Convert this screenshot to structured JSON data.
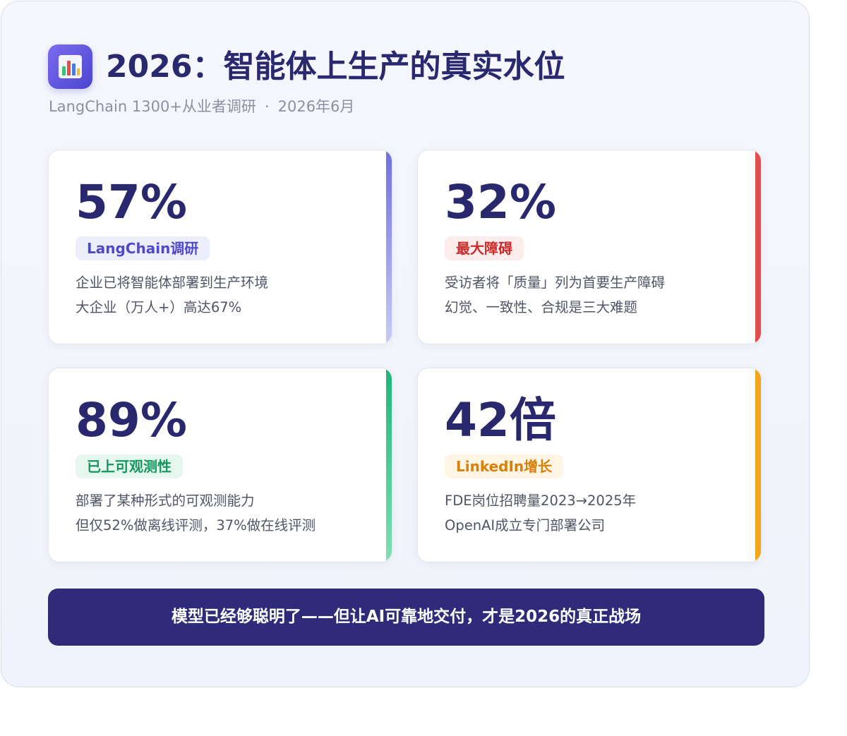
{
  "header": {
    "icon": "bar-chart-icon",
    "title": "2026：智能体上生产的真实水位",
    "subtitle_source": "LangChain 1300+从业者调研",
    "subtitle_separator": "·",
    "subtitle_date": "2026年6月"
  },
  "cards": [
    {
      "stat": "57%",
      "tag": "LangChain调研",
      "line1": "企业已将智能体部署到生产环境",
      "line2": "大企业（万人+）高达67%",
      "accent_color": "#6f6fe0",
      "tag_bg": "#eceefb",
      "tag_color": "#4f48c9"
    },
    {
      "stat": "32%",
      "tag": "最大障碍",
      "line1": "受访者将「质量」列为首要生产障碍",
      "line2": "幻觉、一致性、合规是三大难题",
      "accent_color": "#e24c4c",
      "tag_bg": "#fdecec",
      "tag_color": "#cc2b2b"
    },
    {
      "stat": "89%",
      "tag": "已上可观测性",
      "line1": "部署了某种形式的可观测能力",
      "line2": "但仅52%做离线评测，37%做在线评测",
      "accent_color": "#2bbf85",
      "tag_bg": "#e6f7ef",
      "tag_color": "#16965e"
    },
    {
      "stat": "42倍",
      "tag": "LinkedIn增长",
      "line1": "FDE岗位招聘量2023→2025年",
      "line2": "OpenAI成立专门部署公司",
      "accent_color": "#f2a618",
      "tag_bg": "#fef5e4",
      "tag_color": "#d9800b"
    }
  ],
  "footer": {
    "text": "模型已经够聪明了——但让AI可靠地交付，才是2026的真正战场"
  }
}
